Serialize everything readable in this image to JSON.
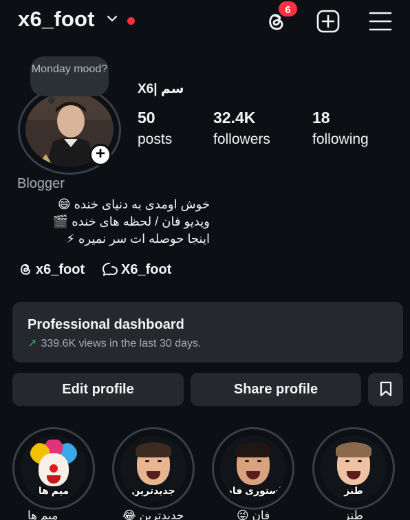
{
  "header": {
    "username": "x6_foot",
    "notification_badge": "6"
  },
  "profile": {
    "note": "Monday mood?",
    "full_name": "X6| سم",
    "stats": [
      {
        "value": "50",
        "label": "posts"
      },
      {
        "value": "32.4K",
        "label": "followers"
      },
      {
        "value": "18",
        "label": "following"
      }
    ],
    "category": "Blogger",
    "bio": [
      "خوش اومدی به دنیای خنده 😄",
      "ویدیو فان / لحظه های خنده 🎬",
      "اینجا حوصله ات سر نمیره ⚡"
    ],
    "links": [
      {
        "icon": "threads-icon",
        "text": "x6_foot"
      },
      {
        "icon": "chat-icon",
        "text": "X6_foot"
      }
    ]
  },
  "dashboard": {
    "title": "Professional dashboard",
    "subtitle": "339.6K views in the last 30 days."
  },
  "buttons": {
    "edit": "Edit profile",
    "share": "Share profile"
  },
  "highlights": [
    {
      "label": "میم ها",
      "under": "میم ها"
    },
    {
      "label": "جدیدترین",
      "under": "جدیدترین 😂"
    },
    {
      "label": "استوری فان",
      "under": "فان 😜"
    },
    {
      "label": "طنز",
      "under": "طنز"
    }
  ],
  "colors": {
    "background": "#0c1014",
    "card": "#25292e",
    "accent_red": "#ff3040",
    "trend_green": "#30b369"
  }
}
